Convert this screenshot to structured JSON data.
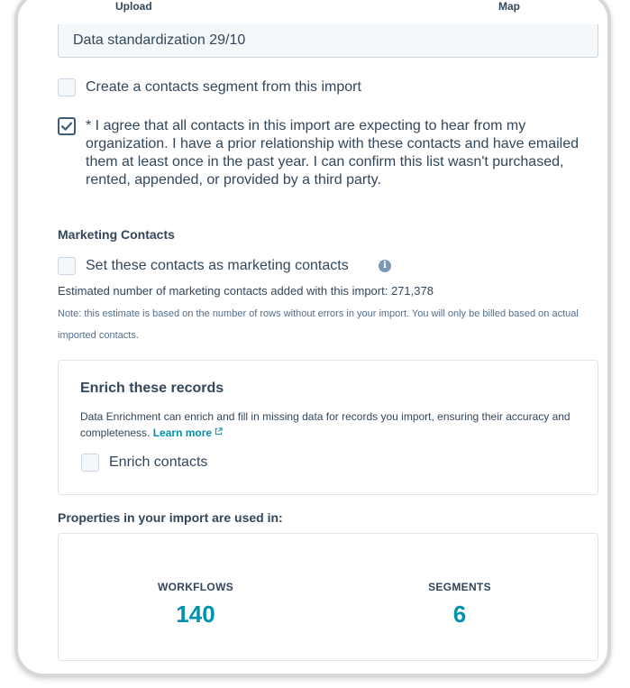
{
  "steps": {
    "upload": "Upload",
    "map": "Map"
  },
  "import_name": {
    "value": "Data standardization 29/10"
  },
  "segment_option": {
    "label": "Create a contacts segment from this import",
    "checked": false
  },
  "consent": {
    "text": "* I agree that all contacts in this import are expecting to hear from my organization. I have a prior relationship with these contacts and have emailed them at least once in the past year. I can confirm this list wasn't purchased, rented, appended, or provided by a third party.",
    "checked": true
  },
  "marketing": {
    "title": "Marketing Contacts",
    "set_label": "Set these contacts as marketing contacts",
    "info_glyph": "i",
    "estimate": "Estimated number of marketing contacts added with this import: 271,378",
    "note": "Note: this estimate is based on the number of rows without errors in your import. You will only be billed based on actual imported contacts."
  },
  "enrich": {
    "title": "Enrich these records",
    "description": "Data Enrichment can enrich and fill in missing data for records you import, ensuring their accuracy and completeness.",
    "learn_more": "Learn more",
    "checkbox_label": "Enrich contacts"
  },
  "properties": {
    "title": "Properties in your import are used in:",
    "workflows_label": "WORKFLOWS",
    "workflows_count": "140",
    "segments_label": "SEGMENTS",
    "segments_count": "6"
  },
  "colors": {
    "accent": "#0091ae",
    "text": "#33475b",
    "border": "#cbd6e2",
    "check": "#425b76"
  },
  "icons": {
    "info": "info-icon",
    "external_link": "external-link-icon",
    "checkmark": "checkmark-icon"
  }
}
